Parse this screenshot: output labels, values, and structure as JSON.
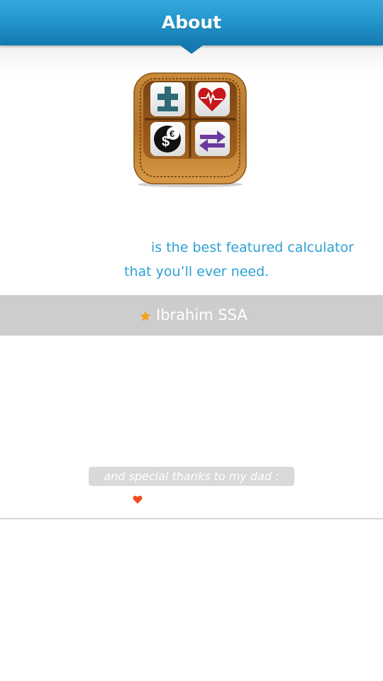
{
  "header": {
    "title": "About"
  },
  "app": {
    "icon": "calculator-app-icon"
  },
  "tagline": {
    "line1": "is the best featured calculator",
    "line2": "that you’ll ever need."
  },
  "author": {
    "icon": "star-icon",
    "name": "Ibrahim SSA"
  },
  "thanks": {
    "text": "and special thanks to my dad :",
    "icon": "heart-icon"
  },
  "colors": {
    "header": "#1e8fc6",
    "tagline": "#2ea0d3",
    "author_bar": "#cdcdcd",
    "star": "#f2a31c",
    "heart": "#ee4b1e"
  }
}
